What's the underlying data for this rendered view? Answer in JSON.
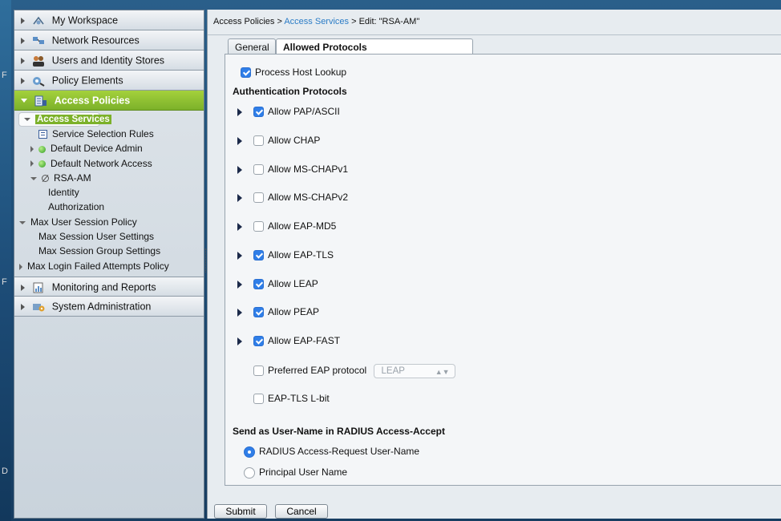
{
  "desktop": {
    "labels": [
      "F",
      "F",
      "D"
    ]
  },
  "sidebar": {
    "drawers_top": [
      {
        "label": "My Workspace",
        "icon": "workspace-icon"
      },
      {
        "label": "Network Resources",
        "icon": "network-icon"
      },
      {
        "label": "Users and Identity Stores",
        "icon": "users-icon"
      },
      {
        "label": "Policy Elements",
        "icon": "policy-elements-icon"
      }
    ],
    "active_drawer": {
      "label": "Access Policies",
      "icon": "access-policies-icon"
    },
    "tree": {
      "access_services": "Access Services",
      "service_selection_rules": "Service Selection Rules",
      "default_device_admin": "Default Device Admin",
      "default_network_access": "Default Network Access",
      "rsa_am": "RSA-AM",
      "identity": "Identity",
      "authorization": "Authorization",
      "max_user_session_policy": "Max User Session Policy",
      "max_session_user_settings": "Max Session User Settings",
      "max_session_group_settings": "Max Session Group Settings",
      "max_login_failed": "Max Login Failed Attempts Policy"
    },
    "drawers_bottom": [
      {
        "label": "Monitoring and Reports",
        "icon": "monitoring-icon"
      },
      {
        "label": "System Administration",
        "icon": "system-admin-icon"
      }
    ]
  },
  "breadcrumb": {
    "part1": "Access Policies > ",
    "link": "Access Services",
    "part2": " > Edit: \"RSA-AM\""
  },
  "tabs": {
    "general": "General",
    "allowed": "Allowed Protocols"
  },
  "form": {
    "process_host_lookup": {
      "label": "Process Host Lookup",
      "checked": true
    },
    "auth_heading": "Authentication Protocols",
    "protocols": [
      {
        "label": "Allow PAP/ASCII",
        "checked": true
      },
      {
        "label": "Allow CHAP",
        "checked": false
      },
      {
        "label": "Allow MS-CHAPv1",
        "checked": false
      },
      {
        "label": "Allow MS-CHAPv2",
        "checked": false
      },
      {
        "label": "Allow EAP-MD5",
        "checked": false
      },
      {
        "label": "Allow EAP-TLS",
        "checked": true
      },
      {
        "label": "Allow LEAP",
        "checked": true
      },
      {
        "label": "Allow PEAP",
        "checked": true
      },
      {
        "label": "Allow EAP-FAST",
        "checked": true
      }
    ],
    "preferred_eap": {
      "label": "Preferred EAP protocol",
      "checked": false,
      "value": "LEAP"
    },
    "eap_tls_lbit": {
      "label": "EAP-TLS L-bit",
      "checked": false
    },
    "send_heading": "Send as User-Name in RADIUS Access-Accept",
    "radios": [
      {
        "label": "RADIUS Access-Request User-Name",
        "selected": true
      },
      {
        "label": "Principal User Name",
        "selected": false
      }
    ]
  },
  "buttons": {
    "submit": "Submit",
    "cancel": "Cancel"
  },
  "colors": {
    "accent_green": "#7cb12a",
    "link_blue": "#2b7cc6",
    "check_blue": "#2f7ee8"
  }
}
